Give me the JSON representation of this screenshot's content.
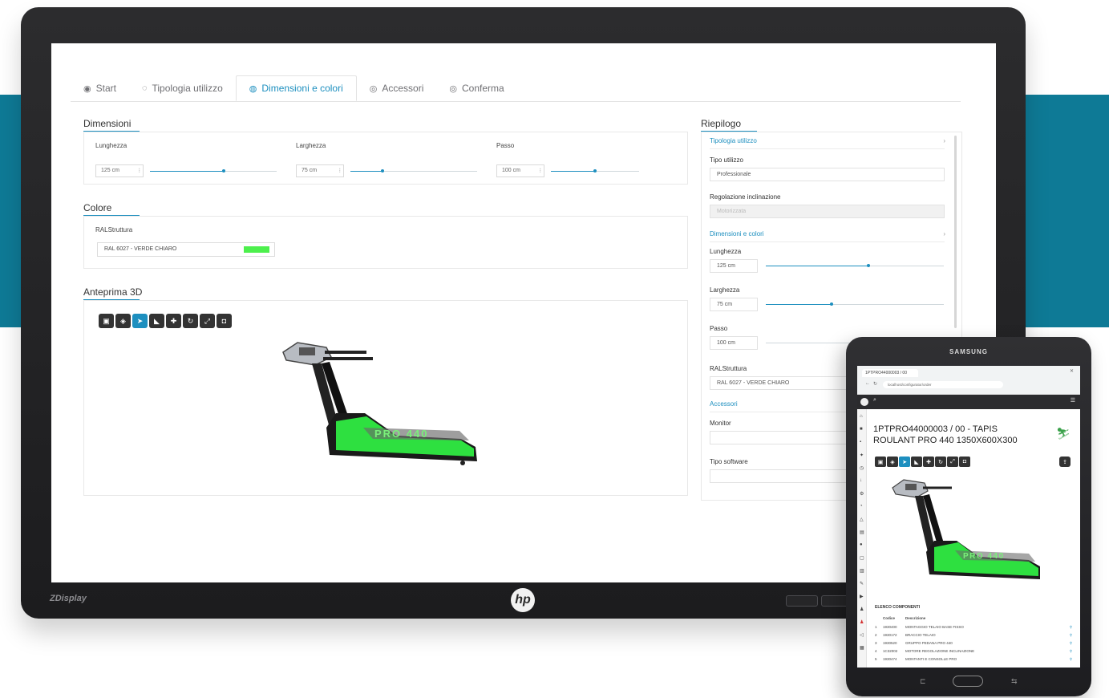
{
  "tabs": [
    {
      "icon": "eye-icon",
      "glyph": "◉",
      "label": "Start"
    },
    {
      "icon": "refresh-icon",
      "glyph": "◌",
      "label": "Tipologia utilizzo"
    },
    {
      "icon": "palette-icon",
      "glyph": "◍",
      "label": "Dimensioni e colori"
    },
    {
      "icon": "settings-icon",
      "glyph": "◎",
      "label": "Accessori"
    },
    {
      "icon": "check-icon",
      "glyph": "◎",
      "label": "Conferma"
    }
  ],
  "dimensioni": {
    "title": "Dimensioni",
    "lunghezza": {
      "label": "Lunghezza",
      "value": "125 cm",
      "slider_fraction": 0.58
    },
    "larghezza": {
      "label": "Larghezza",
      "value": "75 cm",
      "slider_fraction": 0.25
    },
    "passo": {
      "label": "Passo",
      "value": "100 cm",
      "slider_fraction": 0.5
    }
  },
  "colore": {
    "title": "Colore",
    "ral_label": "RALStruttura",
    "ral_value": "RAL 6027 - VERDE CHIARO",
    "swatch_color": "#4df04d"
  },
  "anteprima": {
    "title": "Anteprima 3D",
    "model_label": "PRO 440"
  },
  "riepilogo": {
    "title": "Riepilogo",
    "tipologia_link": "Tipologia utilizzo",
    "tipo_utilizzo_label": "Tipo utilizzo",
    "tipo_utilizzo_value": "Professionale",
    "regolazione_label": "Regolazione inclinazione",
    "regolazione_value": "Motorizzata",
    "dimensioni_link": "Dimensioni e colori",
    "lunghezza_label": "Lunghezza",
    "lunghezza_value": "125 cm",
    "larghezza_label": "Larghezza",
    "larghezza_value": "75 cm",
    "passo_label": "Passo",
    "passo_value": "100 cm",
    "ral_label": "RALStruttura",
    "ral_value": "RAL 6027 - VERDE CHIARO",
    "accessori_link": "Accessori",
    "monitor_label": "Monitor",
    "software_label": "Tipo software"
  },
  "monitor": {
    "brand": "ZDisplay",
    "logo": "hp"
  },
  "tablet": {
    "brand": "SAMSUNG",
    "browser_tab": "1PTPRO44000003 / 00",
    "url": "localhost/configurator/order",
    "title": "1PTPRO44000003 / 00 - TAPIS ROULANT PRO 440 1350X600X300",
    "model_label": "PRO 440",
    "table_title": "ELENCO COMPONENTI",
    "columns": [
      "",
      "Codice",
      "Descrizione"
    ],
    "rows": [
      [
        "1",
        "1930400",
        "MONTAGGIO TELAIO BASE FISSO"
      ],
      [
        "2",
        "1930172",
        "BRACCIO TELAIO"
      ],
      [
        "3",
        "1930520",
        "GRUPPO PEDANA PRO 440"
      ],
      [
        "4",
        "1C32002",
        "MOTORE REGOLAZIONE INCLINAZIONE"
      ],
      [
        "5",
        "1930474",
        "MONTANTI E CONSOLLE PRO"
      ]
    ]
  },
  "colors": {
    "accent": "#1d8fbf",
    "band": "#0e7a96",
    "frame_green": "#2ee040"
  }
}
